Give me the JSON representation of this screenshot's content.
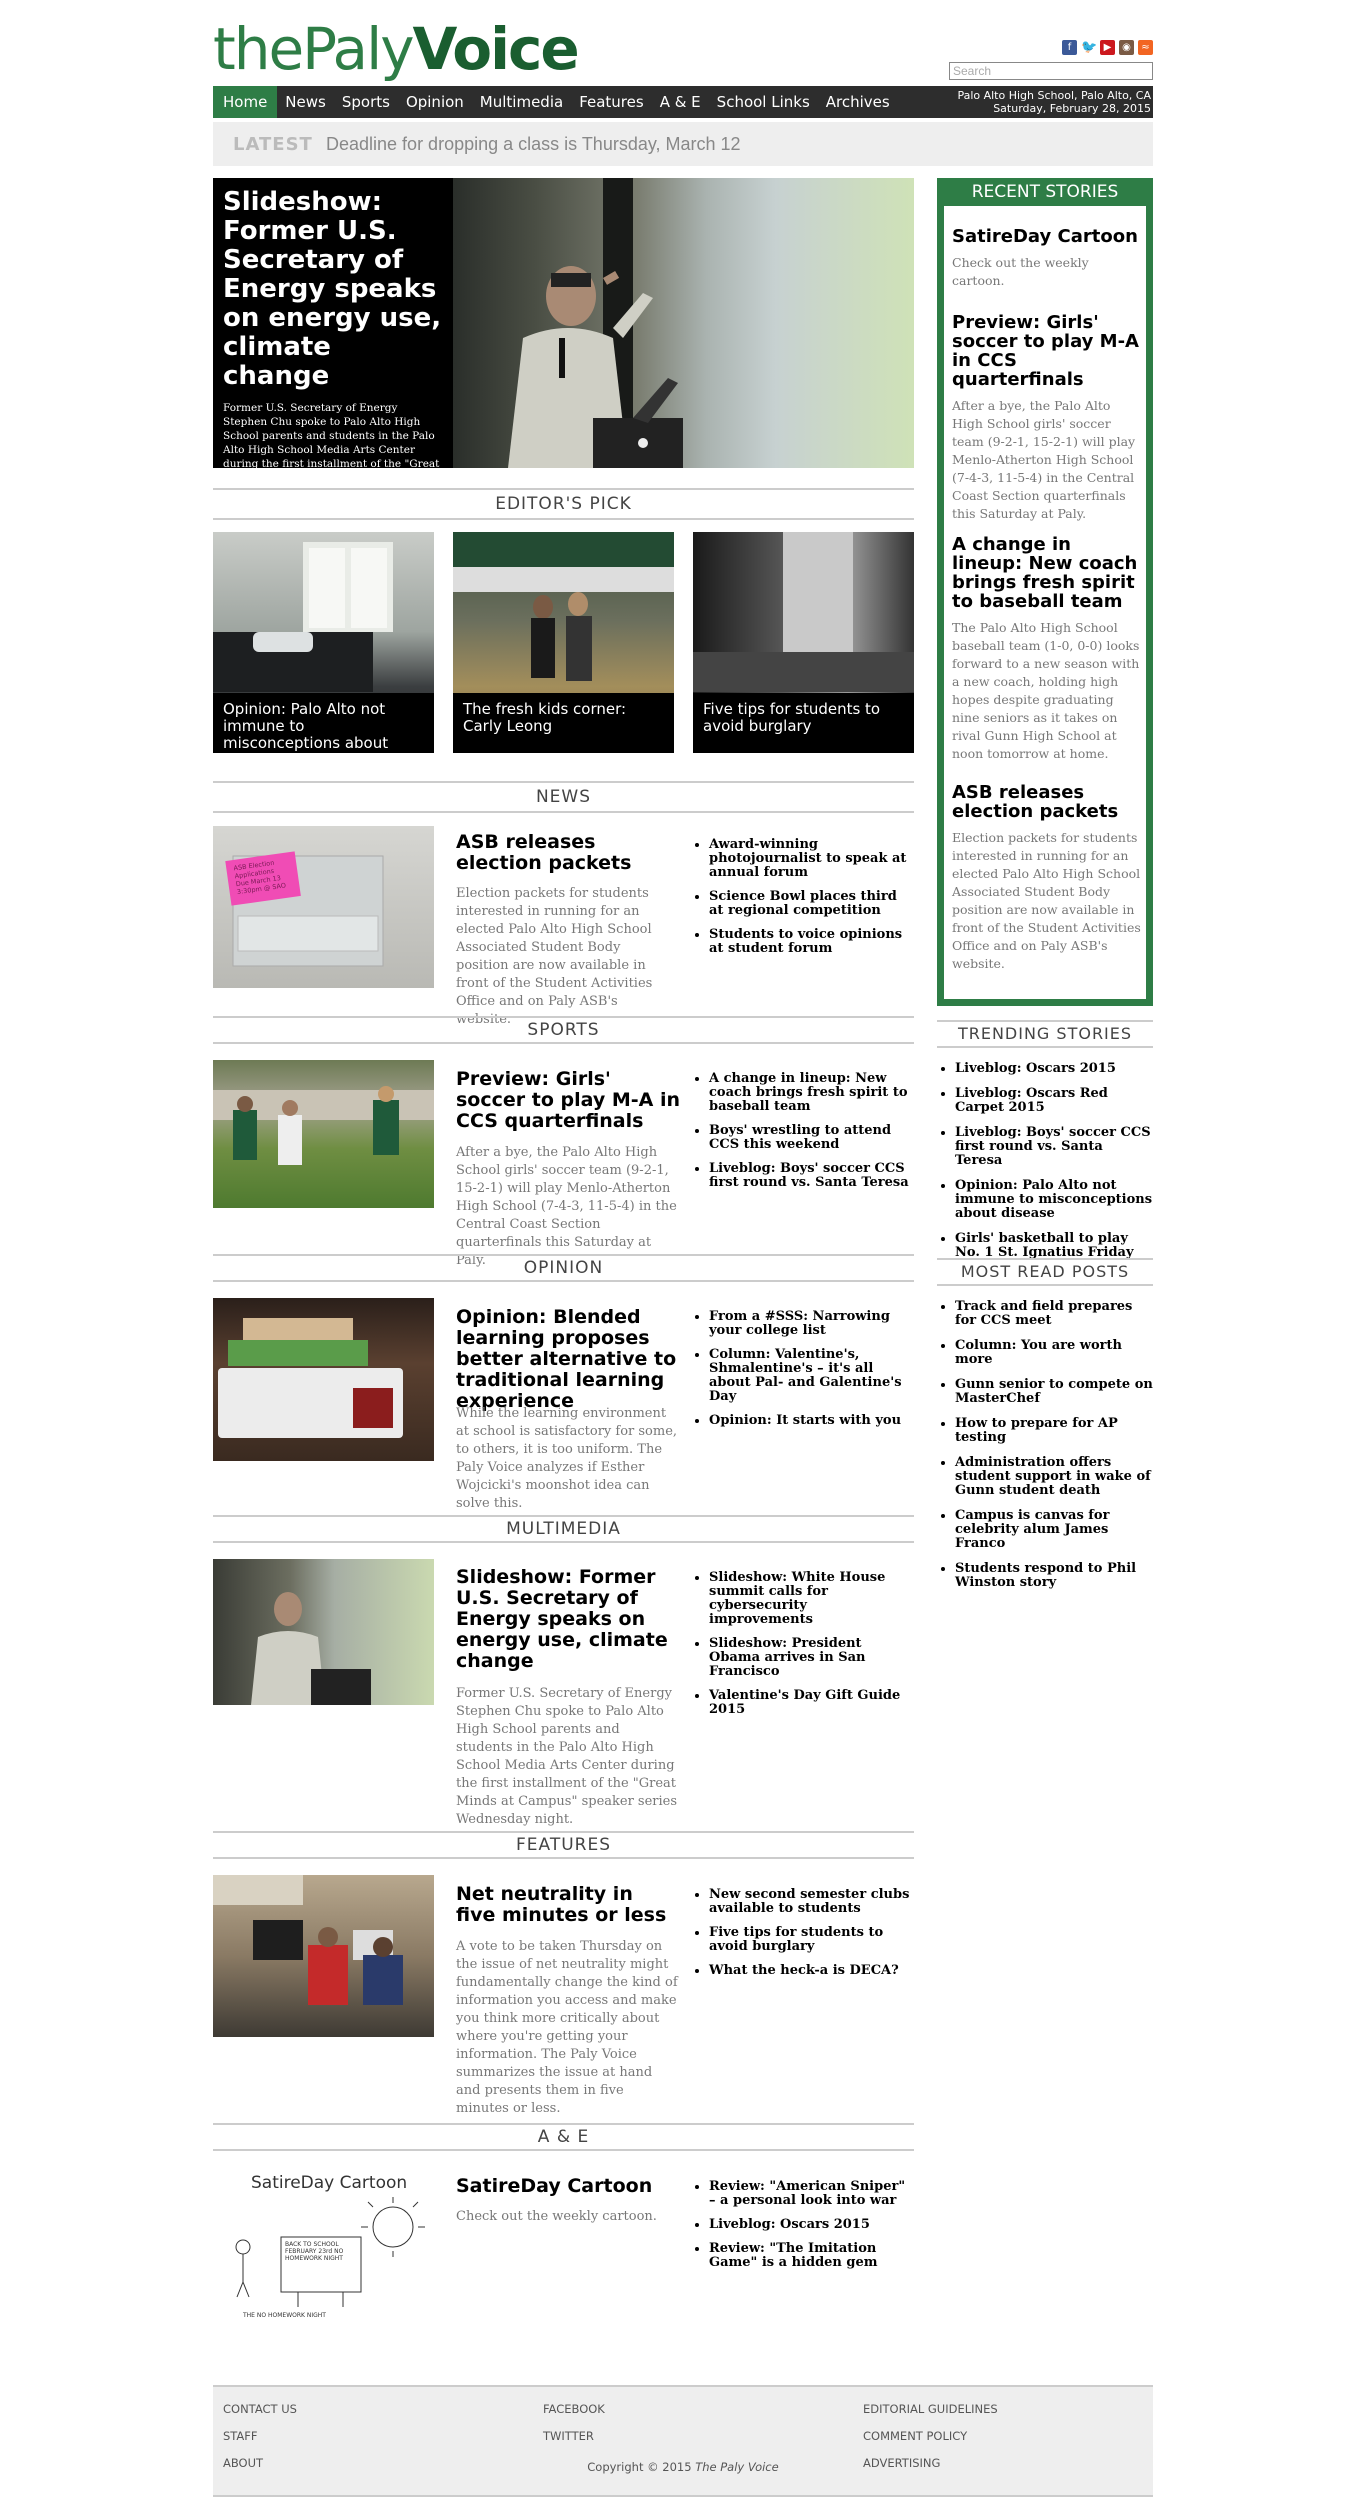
{
  "header": {
    "logo_part1": "thePaly",
    "logo_part2": "Voice",
    "search_placeholder": "Search",
    "location": "Palo Alto High School, Palo Alto, CA",
    "date": "Saturday, February 28, 2015",
    "social_icons": [
      "facebook-icon",
      "twitter-icon",
      "youtube-icon",
      "instagram-icon",
      "rss-icon"
    ]
  },
  "nav": [
    "Home",
    "News",
    "Sports",
    "Opinion",
    "Multimedia",
    "Features",
    "A & E",
    "School Links",
    "Archives"
  ],
  "latest": {
    "label": "LATEST",
    "text": "Deadline for dropping a class is Thursday, March 12"
  },
  "hero": {
    "title": "Slideshow: Former U.S. Secretary of Energy speaks on energy use, climate change",
    "desc": "Former U.S. Secretary of Energy Stephen Chu spoke to Palo Alto High School parents and students in the Palo Alto High School Media Arts Center during the first installment of the \"Great Minds at Campus\" speaker series Wednesday night."
  },
  "editors_pick": {
    "heading": "EDITOR'S PICK",
    "items": [
      "Opinion: Palo Alto not immune to misconceptions about disease",
      "The fresh kids corner: Carly Leong",
      "Five tips for students to avoid burglary"
    ]
  },
  "sections": [
    {
      "heading": "NEWS",
      "title": "ASB releases election packets",
      "desc": "Election packets for students interested in running for an elected Palo Alto High School Associated Student Body position are now available in front of the Student Activities Office and on Paly ASB's website.",
      "bullets": [
        "Award-winning photojournalist to speak at annual forum",
        "Science Bowl places third at regional competition",
        "Students to voice opinions at student forum"
      ]
    },
    {
      "heading": "SPORTS",
      "title": "Preview: Girls' soccer to play M-A in CCS quarterfinals",
      "desc": "After a bye, the Palo Alto High School girls' soccer team (9-2-1, 15-2-1) will play Menlo-Atherton High School (7-4-3, 11-5-4) in the Central Coast Section quarterfinals this Saturday at Paly.",
      "bullets": [
        "A change in lineup: New coach brings fresh spirit to baseball team",
        "Boys' wrestling to attend CCS this weekend",
        "Liveblog: Boys' soccer CCS first round vs. Santa Teresa"
      ]
    },
    {
      "heading": "OPINION",
      "title": "Opinion: Blended learning proposes better alternative to traditional learning experience",
      "desc": "While the learning environment at school is satisfactory for some, to others, it is too uniform. The Paly Voice analyzes if Esther Wojcicki's moonshot idea can solve this.",
      "bullets": [
        "From a #SSS: Narrowing your college list",
        "Column: Valentine's, Shmalentine's – it's all about Pal- and Galentine's Day",
        "Opinion: It starts with you"
      ]
    },
    {
      "heading": "MULTIMEDIA",
      "title": "Slideshow: Former U.S. Secretary of Energy speaks on energy use, climate change",
      "desc": "Former U.S. Secretary of Energy Stephen Chu spoke to Palo Alto High School parents and students in the Palo Alto High School Media Arts Center during the first installment of the \"Great Minds at Campus\" speaker series Wednesday night.",
      "bullets": [
        "Slideshow: White House summit calls for cybersecurity improvements",
        "Slideshow: President Obama arrives in San Francisco",
        "Valentine's Day Gift Guide 2015"
      ]
    },
    {
      "heading": "FEATURES",
      "title": "Net neutrality in five minutes or less",
      "desc": "A vote to be taken Thursday on the issue of net neutrality might fundamentally change the kind of information you access and make you think more critically about where you're getting your information. The Paly Voice summarizes the issue at hand and presents them in five minutes or less.",
      "bullets": [
        "New second semester clubs available to students",
        "Five tips for students to avoid burglary",
        "What the heck-a is DECA?"
      ]
    },
    {
      "heading": "A & E",
      "title": "SatireDay Cartoon",
      "desc": "Check out the weekly cartoon.",
      "bullets": [
        "Review: \"American Sniper\" – a personal look into war",
        "Liveblog: Oscars 2015",
        "Review: \"The Imitation Game\" is a hidden gem"
      ]
    }
  ],
  "cartoon": {
    "title": "SatireDay Cartoon",
    "sign": "BACK TO SCHOOL FEBRUARY 23rd NO HOMEWORK NIGHT",
    "caption": "THE NO HOMEWORK NIGHT"
  },
  "news_sticky": {
    "line1": "ASB Election",
    "line2": "Applications",
    "line3": "Due March 13",
    "line4": "3:30pm @ SAO"
  },
  "recent": {
    "heading": "RECENT STORIES",
    "items": [
      {
        "title": "SatireDay Cartoon",
        "desc": "Check out the weekly cartoon."
      },
      {
        "title": "Preview: Girls' soccer to play M-A in CCS quarterfinals",
        "desc": "After a bye, the Palo Alto High School girls' soccer team (9-2-1, 15-2-1) will play Menlo-Atherton High School (7-4-3, 11-5-4) in the Central Coast Section quarterfinals this Saturday at Paly."
      },
      {
        "title": "A change in lineup: New coach brings fresh spirit to baseball team",
        "desc": "The Palo Alto High School baseball team (1-0, 0-0) looks forward to a new season with a new coach, holding high hopes despite graduating nine seniors as it takes on rival Gunn High School at noon tomorrow at home."
      },
      {
        "title": "ASB releases election packets",
        "desc": "Election packets for students interested in running for an elected Palo Alto High School Associated Student Body position are now available in front of the Student Activities Office and on Paly ASB's website."
      }
    ]
  },
  "trending": {
    "heading": "TRENDING STORIES",
    "items": [
      "Liveblog: Oscars 2015",
      "Liveblog: Oscars Red Carpet 2015",
      "Liveblog: Boys' soccer CCS first round vs. Santa Teresa",
      "Opinion: Palo Alto not immune to misconceptions about disease",
      "Girls' basketball to play No. 1 St. Ignatius Friday"
    ]
  },
  "most_read": {
    "heading": "MOST READ POSTS",
    "items": [
      "Track and field prepares for CCS meet",
      "Column: You are worth more",
      "Gunn senior to compete on MasterChef",
      "How to prepare for AP testing",
      "Administration offers student support in wake of Gunn student death",
      "Campus is canvas for celebrity alum James Franco",
      "Students respond to Phil Winston story"
    ]
  },
  "footer": {
    "col1": [
      "CONTACT US",
      "STAFF",
      "ABOUT"
    ],
    "col2": [
      "FACEBOOK",
      "TWITTER"
    ],
    "col3": [
      "EDITORIAL GUIDELINES",
      "COMMENT POLICY",
      "ADVERTISING"
    ],
    "copyright_prefix": "Copyright © 2015 ",
    "copyright_name": "The Paly Voice"
  },
  "colors": {
    "brand_green": "#2e7d46",
    "nav_dark": "#2d2d2d",
    "footer_gray": "#eeeeee"
  }
}
